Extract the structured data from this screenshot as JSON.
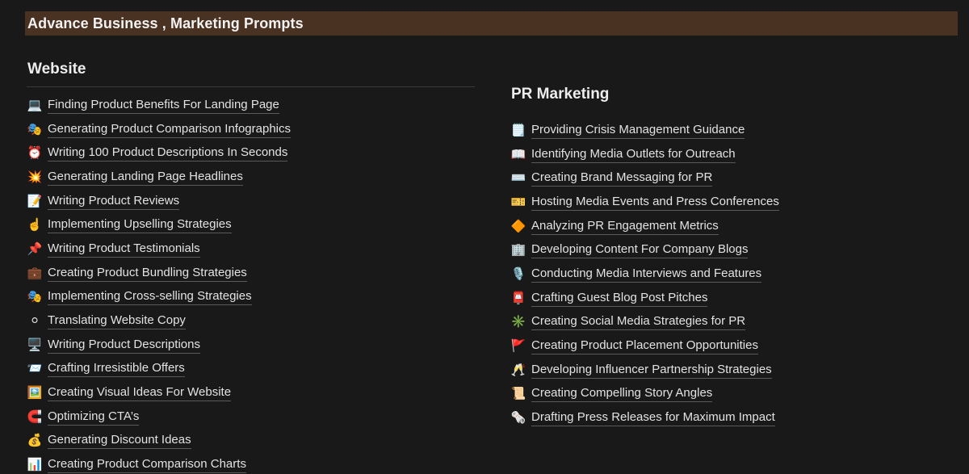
{
  "page": {
    "title": "Advance Business , Marketing Prompts"
  },
  "website": {
    "heading": "Website",
    "items": [
      {
        "icon": "💻",
        "icon_name": "laptop-icon",
        "label": "Finding Product Benefits For Landing Page"
      },
      {
        "icon": "🎭",
        "icon_name": "theater-masks-icon",
        "label": "Generating Product Comparison Infographics"
      },
      {
        "icon": "⏰",
        "icon_name": "alarm-clock-icon",
        "label": "Writing 100 Product Descriptions In Seconds"
      },
      {
        "icon": "💥",
        "icon_name": "collision-icon",
        "label": "Generating Landing Page Headlines"
      },
      {
        "icon": "📝",
        "icon_name": "memo-icon",
        "label": "Writing Product Reviews"
      },
      {
        "icon": "☝️",
        "icon_name": "pointing-finger-icon",
        "label": "Implementing Upselling Strategies"
      },
      {
        "icon": "📌",
        "icon_name": "pushpin-icon",
        "label": "Writing Product Testimonials"
      },
      {
        "icon": "💼",
        "icon_name": "briefcase-icon",
        "label": "Creating Product Bundling Strategies"
      },
      {
        "icon": "🎭",
        "icon_name": "theater-masks-icon",
        "label": "Implementing Cross-selling Strategies"
      },
      {
        "icon": "⚪",
        "icon_name": "white-circle-icon",
        "label": "Translating Website Copy"
      },
      {
        "icon": "🖥️",
        "icon_name": "desktop-computer-icon",
        "label": "Writing Product Descriptions"
      },
      {
        "icon": "📨",
        "icon_name": "incoming-envelope-icon",
        "label": "Crafting Irresistible Offers"
      },
      {
        "icon": "🖼️",
        "icon_name": "framed-picture-icon",
        "label": "Creating Visual Ideas For Website"
      },
      {
        "icon": "🧲",
        "icon_name": "magnet-icon",
        "label": "Optimizing CTA’s"
      },
      {
        "icon": "💰",
        "icon_name": "money-bag-icon",
        "label": "Generating Discount Ideas"
      },
      {
        "icon": "📊",
        "icon_name": "bar-chart-icon",
        "label": "Creating Product Comparison Charts"
      }
    ]
  },
  "pr_marketing": {
    "heading": "PR Marketing",
    "items": [
      {
        "icon": "🗒️",
        "icon_name": "notepad-icon",
        "label": "Providing Crisis Management Guidance"
      },
      {
        "icon": "📖",
        "icon_name": "open-book-icon",
        "label": "Identifying Media Outlets for Outreach"
      },
      {
        "icon": "⌨️",
        "icon_name": "keyboard-icon",
        "label": "Creating Brand Messaging for PR"
      },
      {
        "icon": "🎫",
        "icon_name": "ticket-icon",
        "label": "Hosting Media Events and Press Conferences"
      },
      {
        "icon": "🔶",
        "icon_name": "orange-diamond-icon",
        "label": "Analyzing PR Engagement Metrics"
      },
      {
        "icon": "🏢",
        "icon_name": "office-building-icon",
        "label": "Developing Content For Company Blogs"
      },
      {
        "icon": "🎙️",
        "icon_name": "microphone-icon",
        "label": "Conducting Media Interviews and Features"
      },
      {
        "icon": "📮",
        "icon_name": "postbox-icon",
        "label": "Crafting Guest Blog Post Pitches"
      },
      {
        "icon": "✳️",
        "icon_name": "asterisk-icon",
        "label": "Creating Social Media Strategies for PR"
      },
      {
        "icon": "🚩",
        "icon_name": "red-flag-icon",
        "label": "Creating Product Placement Opportunities"
      },
      {
        "icon": "🥂",
        "icon_name": "champagne-glasses-icon",
        "label": "Developing Influencer Partnership Strategies"
      },
      {
        "icon": "📜",
        "icon_name": "scroll-icon",
        "label": "Creating Compelling Story Angles"
      },
      {
        "icon": "🗞️",
        "icon_name": "newspaper-icon",
        "label": "Drafting Press Releases for Maximum Impact"
      }
    ]
  }
}
